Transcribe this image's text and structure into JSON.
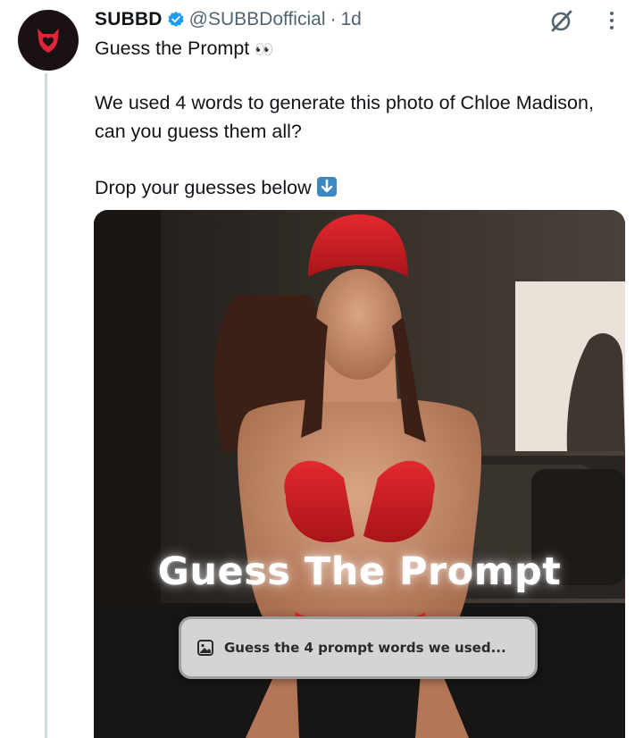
{
  "tweet": {
    "author_name": "SUBBD",
    "handle": "@SUBBDofficial",
    "separator": "·",
    "time": "1d",
    "lines": [
      "Guess the Prompt",
      "We used 4 words to generate this photo of Chloe Madison,",
      "can you guess them all?",
      "Drop your guesses below"
    ],
    "emoji_eyes": "👀",
    "emoji_down_arrow": "⬇️"
  },
  "media": {
    "overlay_title": "Guess The Prompt",
    "prompt_box_text": "Guess the 4 prompt words we used..."
  },
  "icons": {
    "avatar": "devil-shield-logo-icon",
    "verified": "verified-badge-icon",
    "grok": "grok-icon",
    "more": "more-dots-icon",
    "prompt": "image-icon"
  },
  "colors": {
    "verified_blue": "#1d9bf0",
    "avatar_bg": "#1b1113",
    "avatar_logo": "#e0243a",
    "secondary_text": "#536471",
    "thread_line": "#cfd9de",
    "swimsuit_red": "#d21f25"
  }
}
